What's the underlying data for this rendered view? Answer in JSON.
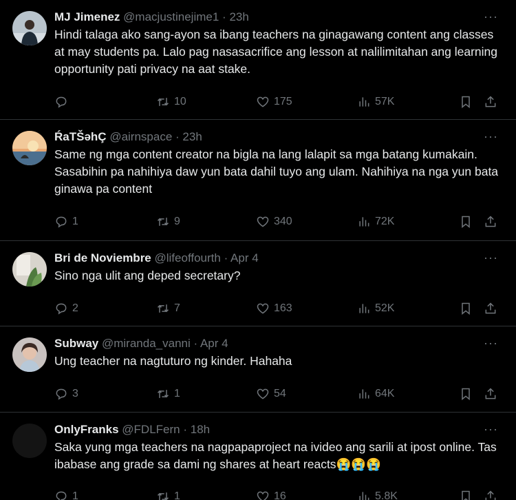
{
  "tweets": [
    {
      "name": "MJ Jimenez",
      "handle": "@macjustinejime1",
      "time": "23h",
      "text": "Hindi talaga ako sang-ayon sa ibang teachers na ginagawang content ang classes at may students pa. Lalo pag nasasacrifice ang lesson at nalilimitahan ang learning opportunity pati privacy na aat stake.",
      "replies": "",
      "retweets": "10",
      "likes": "175",
      "views": "57K"
    },
    {
      "name": "ŔaTŠəhÇ",
      "handle": "@airnspace",
      "time": "23h",
      "text": "Same ng mga content creator na bigla na lang lalapit sa mga batang kumakain. Sasabihin pa nahihiya daw yun bata dahil tuyo ang ulam. Nahihiya na nga yun bata ginawa pa content",
      "replies": "1",
      "retweets": "9",
      "likes": "340",
      "views": "72K"
    },
    {
      "name": "Bri de Noviembre",
      "handle": "@lifeoffourth",
      "time": "Apr 4",
      "text": "Sino nga ulit ang deped secretary?",
      "replies": "2",
      "retweets": "7",
      "likes": "163",
      "views": "52K"
    },
    {
      "name": "Subway",
      "handle": "@miranda_vanni",
      "time": "Apr 4",
      "text": "Ung teacher na nagtuturo ng kinder. Hahaha",
      "replies": "3",
      "retweets": "1",
      "likes": "54",
      "views": "64K"
    },
    {
      "name": "OnlyFranks",
      "handle": "@FDLFern",
      "time": "18h",
      "text": "Saka yung mga teachers na nagpapaproject na ivideo ang sarili at ipost online. Tas ibabase ang grade sa dami ng shares at heart reacts😭😭😭",
      "replies": "1",
      "retweets": "1",
      "likes": "16",
      "views": "5.8K"
    }
  ],
  "separator": "·",
  "more_glyph": "···",
  "colors": {
    "bg": "#000000",
    "text": "#e7e9ea",
    "muted": "#71767b",
    "border": "#2f3336"
  }
}
